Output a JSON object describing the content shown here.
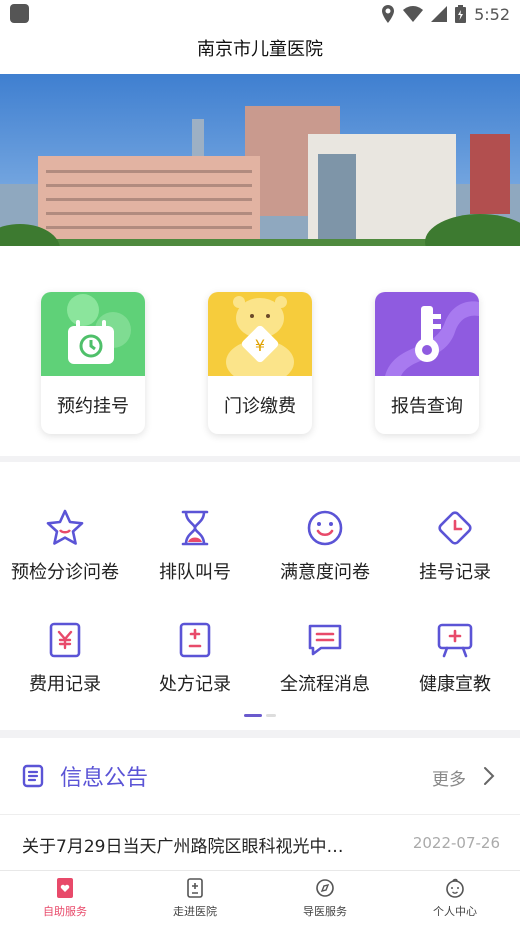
{
  "status_bar": {
    "time": "5:52"
  },
  "header": {
    "title": "南京市儿童医院"
  },
  "quick_actions": [
    {
      "label": "预约挂号",
      "icon": "calendar-clock-icon"
    },
    {
      "label": "门诊缴费",
      "icon": "yuan-bear-icon"
    },
    {
      "label": "报告查询",
      "icon": "key-icon"
    }
  ],
  "services": [
    {
      "label": "预检分诊问卷",
      "icon": "star-icon"
    },
    {
      "label": "排队叫号",
      "icon": "hourglass-icon"
    },
    {
      "label": "满意度问卷",
      "icon": "smiley-icon"
    },
    {
      "label": "挂号记录",
      "icon": "clock-diamond-icon"
    },
    {
      "label": "费用记录",
      "icon": "yuan-card-icon"
    },
    {
      "label": "处方记录",
      "icon": "prescription-icon"
    },
    {
      "label": "全流程消息",
      "icon": "message-icon"
    },
    {
      "label": "健康宣教",
      "icon": "easel-icon"
    }
  ],
  "notice": {
    "title": "信息公告",
    "more_label": "更多",
    "items": [
      {
        "text": "关于7月29日当天广州路院区眼科视光中…",
        "date": "2022-07-26"
      }
    ]
  },
  "tabbar": [
    {
      "label": "自助服务",
      "icon": "self-service-icon",
      "active": true
    },
    {
      "label": "走进医院",
      "icon": "hospital-info-icon",
      "active": false
    },
    {
      "label": "导医服务",
      "icon": "compass-icon",
      "active": false
    },
    {
      "label": "个人中心",
      "icon": "baby-face-icon",
      "active": false
    }
  ],
  "colors": {
    "accent": "#5b54d6",
    "active_tab": "#e84a6a"
  }
}
